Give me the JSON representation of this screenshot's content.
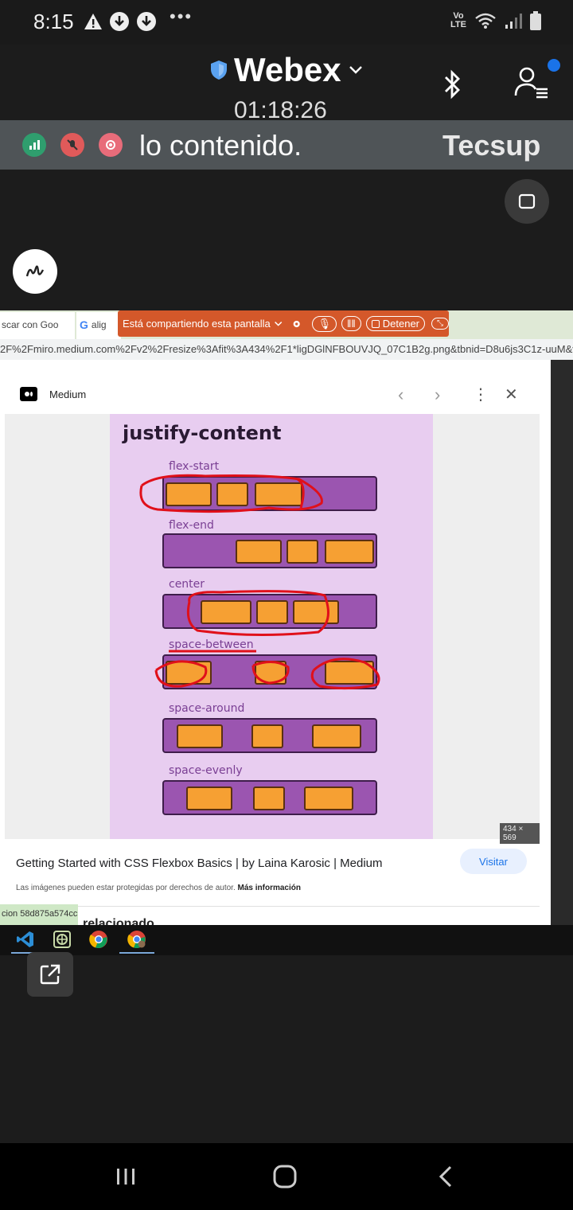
{
  "status": {
    "time": "8:15",
    "dots": "•••",
    "volte": "Vo LTE"
  },
  "webex": {
    "title": "Webex",
    "timer": "01:18:26"
  },
  "ticker": {
    "text": "lo contenido.",
    "text2": "Tecsup"
  },
  "browser": {
    "tab1": "scar con Goo",
    "tab2": "alig",
    "sharing_banner": "Está compartiendo esta pantalla",
    "stop_label": "Detener",
    "url": "2F%2Fmiro.medium.com%2Fv2%2Fresize%3Afit%3A434%2F1*ligDGlNFBOUVJQ_07C1B2g.png&tbnid=D8u6js3C1z-uuM&ve"
  },
  "viewer": {
    "site": "Medium",
    "image_title": "justify-content",
    "rows": [
      "flex-start",
      "flex-end",
      "center",
      "space-between",
      "space-around",
      "space-evenly"
    ],
    "size_badge": "434 × 569",
    "result_title": "Getting Started with CSS Flexbox Basics | by Laina Karosic | Medium",
    "visit_label": "Visitar",
    "rights_text": "Las imágenes pueden estar protegidas por derechos de autor.",
    "rights_link": "Más información",
    "bottom_label": "cion 58d875a574cc",
    "bottom_text": "relacionado"
  },
  "colors": {
    "webex_bg": "#1c1c1c",
    "ticker_bg": "#4f5457",
    "banner": "#d4582a",
    "accent_blue": "#1a73e8",
    "purple_bar": "#9b55b0",
    "orange_box": "#f6a033",
    "annotation_red": "#e0101a"
  }
}
